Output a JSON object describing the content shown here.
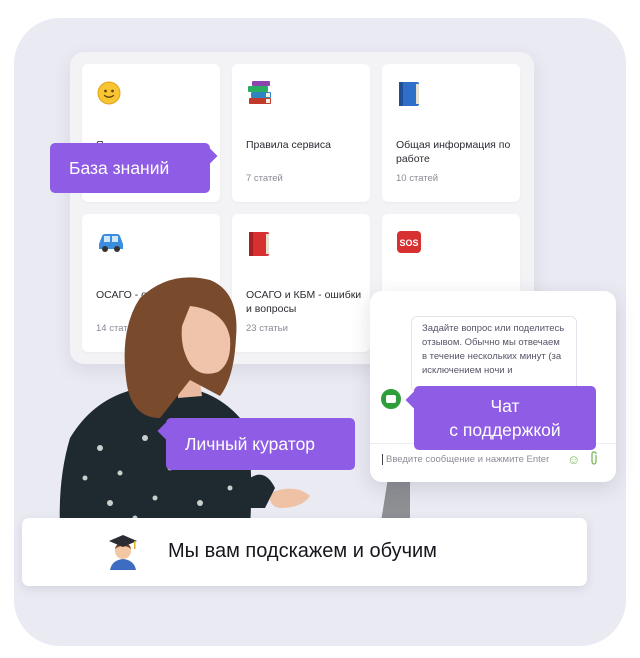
{
  "knowledge_base": {
    "cards": [
      {
        "icon": "smiling-face-icon",
        "title": "Я...",
        "count": ""
      },
      {
        "icon": "books-icon",
        "title": "Правила сервиса",
        "count": "7 статей"
      },
      {
        "icon": "blue-book-icon",
        "title": "Общая информация по работе",
        "count": "10 статей"
      },
      {
        "icon": "car-icon",
        "title": "ОСАГО - о... и оплата",
        "count": "14 статей"
      },
      {
        "icon": "red-book-icon",
        "title": "ОСАГО и КБМ - ошибки и вопросы",
        "count": "23 статьи"
      },
      {
        "icon": "sos-icon",
        "title": "",
        "count": ""
      }
    ]
  },
  "labels": {
    "knowledge_base": "База знаний",
    "curator": "Личный куратор",
    "support_line1": "Чат",
    "support_line2": "с поддержкой"
  },
  "chat": {
    "message": "Задайте вопрос или поделитесь отзывом. Обычно мы отвечаем в течение нескольких минут (за исключением ночи и",
    "input_placeholder": "Введите сообщение и нажмите Enter"
  },
  "bottom_bar": {
    "icon": "student-graduate-icon",
    "text": "Мы вам подскажем и обучим"
  },
  "colors": {
    "accent": "#8f5ce5",
    "chat_green": "#2f9e3a",
    "background": "#eaeaf3"
  }
}
